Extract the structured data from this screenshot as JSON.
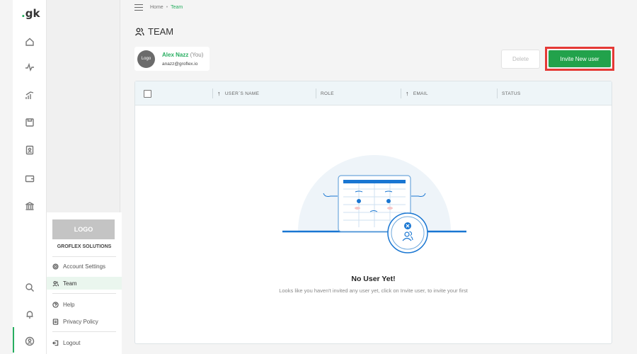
{
  "app": {
    "logo_text": "gk"
  },
  "breadcrumb": {
    "home": "Home",
    "separator": "•",
    "current": "Team"
  },
  "page": {
    "title": "TEAM"
  },
  "current_user": {
    "avatar_text": "Logo",
    "name": "Alex Nazz",
    "you_label": "(You)",
    "email": "anazz@groflex.io"
  },
  "actions": {
    "delete_label": "Delete",
    "invite_label": "Invite New user"
  },
  "table": {
    "columns": [
      {
        "label": "USER`S NAME",
        "sortable": true
      },
      {
        "label": "ROLE",
        "sortable": false
      },
      {
        "label": "EMAIL",
        "sortable": true
      },
      {
        "label": "STATUS",
        "sortable": false
      }
    ]
  },
  "empty_state": {
    "title": "No User Yet!",
    "text": "Looks like you haven't invited any user yet, click on Invite user, to invite your first"
  },
  "account_menu": {
    "logo_text": "LOGO",
    "company": "GROFLEX SOLUTIONS",
    "items": [
      {
        "label": "Account Settings",
        "icon": "gear-icon"
      },
      {
        "label": "Team",
        "icon": "team-icon",
        "active": true
      },
      {
        "label": "Help",
        "icon": "help-icon"
      },
      {
        "label": "Privacy Policy",
        "icon": "policy-icon"
      },
      {
        "label": "Logout",
        "icon": "logout-icon"
      }
    ]
  },
  "rail_icons": [
    "home-icon",
    "activity-icon",
    "growth-icon",
    "save-icon",
    "contacts-icon",
    "wallet-icon",
    "bank-icon",
    "search-icon",
    "bell-icon",
    "user-circle-icon"
  ],
  "colors": {
    "accent": "#27ae60",
    "invite_button": "#22a24b",
    "highlight_border": "#e53935",
    "illustration_blue": "#1976d2"
  }
}
